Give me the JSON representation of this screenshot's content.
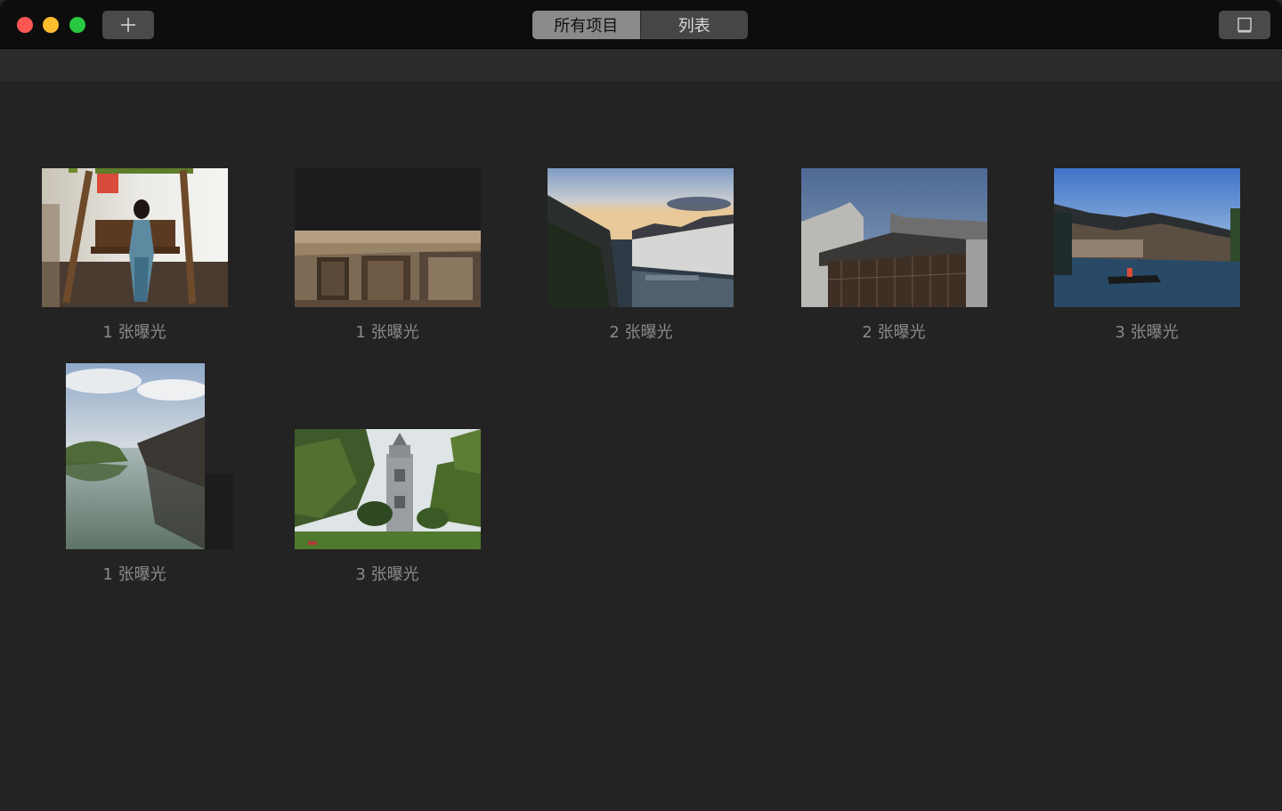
{
  "toolbar": {
    "add_icon": "plus-icon",
    "segments": [
      {
        "label": "所有项目",
        "active": true
      },
      {
        "label": "列表",
        "active": false
      }
    ],
    "sidebar_icon": "sidebar-toggle-icon"
  },
  "items": [
    {
      "caption": "1 张曝光",
      "image": "woman-on-swing-photo"
    },
    {
      "caption": "1 张曝光",
      "image": "sepia-courtyard-photo"
    },
    {
      "caption": "2 张曝光",
      "image": "canal-dusk-photo"
    },
    {
      "caption": "2 张曝光",
      "image": "old-wooden-house-photo"
    },
    {
      "caption": "3 张曝光",
      "image": "waterfront-boat-photo"
    },
    {
      "caption": "1 张曝光",
      "image": "river-reflection-photo"
    },
    {
      "caption": "3 张曝光",
      "image": "bell-tower-park-photo"
    }
  ],
  "colors": {
    "background": "#232323",
    "titlebar": "#0d0d0d",
    "caption": "#8a8a8a",
    "traffic_close": "#fd5753",
    "traffic_min": "#fdbc2e",
    "traffic_max": "#28c840"
  }
}
